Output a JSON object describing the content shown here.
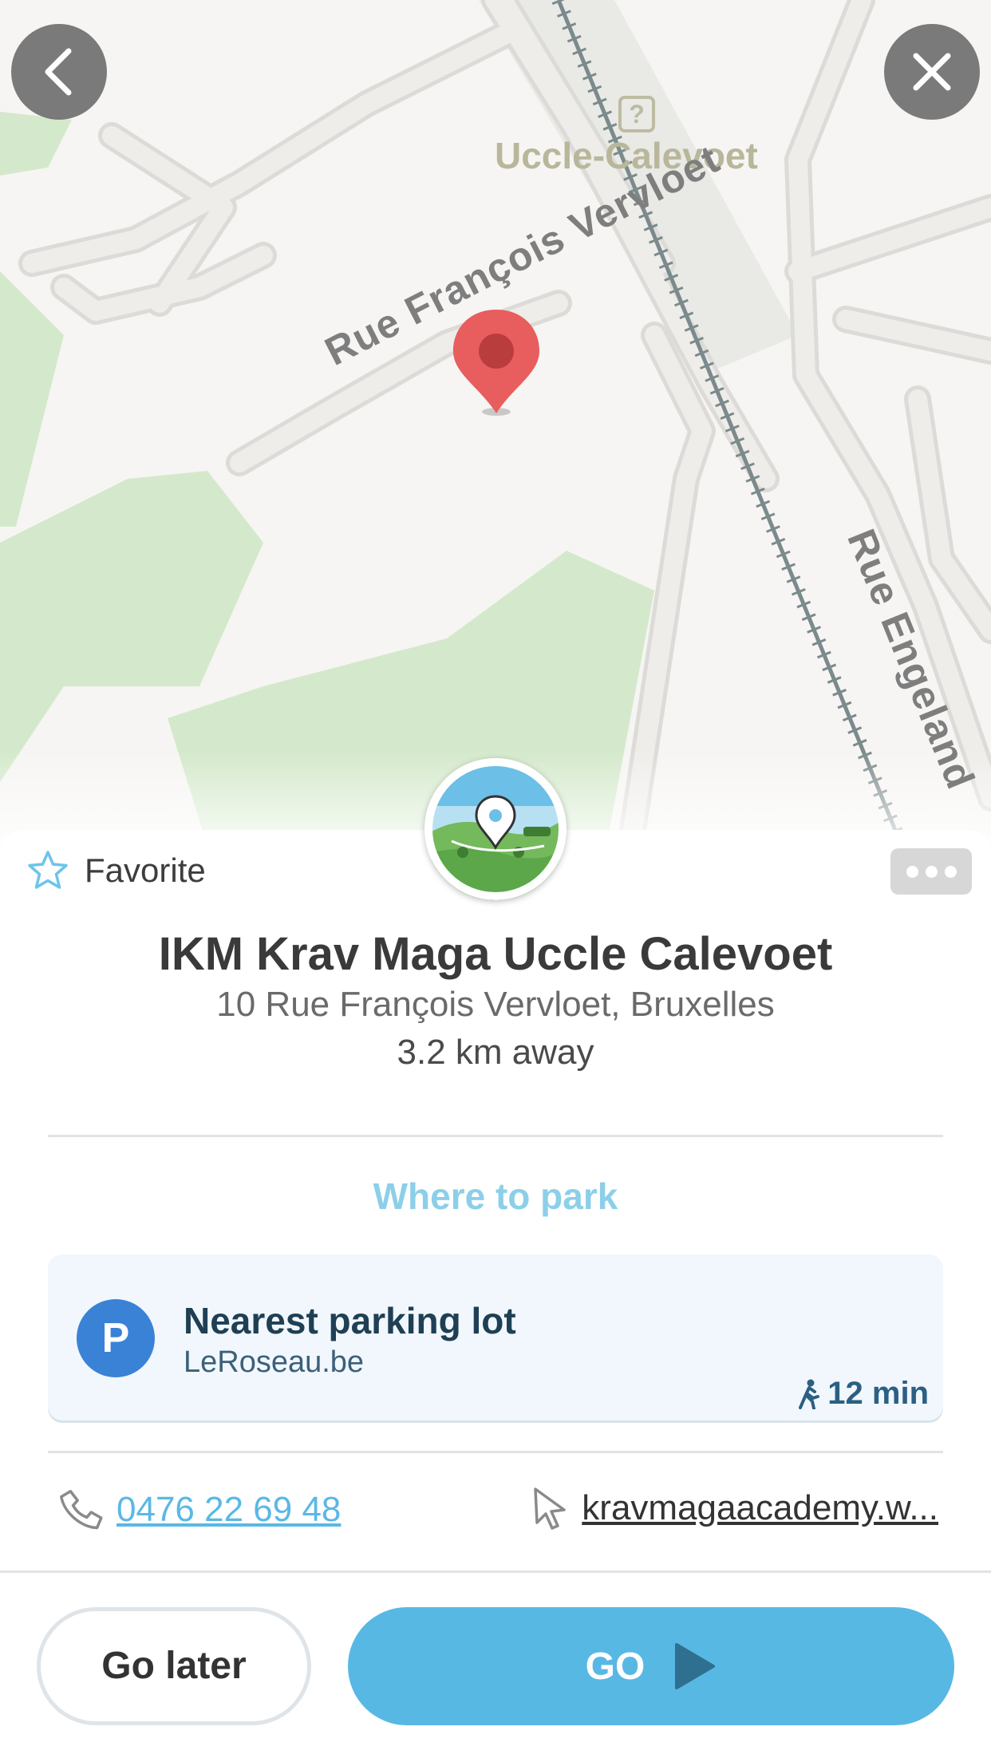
{
  "map": {
    "station_label": "Uccle-Calevoet",
    "street_label_1": "Rue François Vervloet",
    "street_label_2": "Rue Engeland",
    "station_icon": "?"
  },
  "header": {
    "back_icon": "chevron-left-icon",
    "close_icon": "close-icon"
  },
  "sheet": {
    "favorite_label": "Favorite",
    "more_icon": "more-dots-icon",
    "place": {
      "name": "IKM Krav Maga Uccle Calevoet",
      "address": "10 Rue François Vervloet, Bruxelles",
      "distance": "3.2 km away"
    },
    "parking": {
      "header": "Where to park",
      "badge": "P",
      "title": "Nearest parking lot",
      "subtitle": "LeRoseau.be",
      "walk_time": "12 min"
    },
    "contact": {
      "phone": "0476 22 69 48",
      "website": "kravmagaacademy.w..."
    },
    "actions": {
      "go_later": "Go later",
      "go": "GO"
    }
  },
  "colors": {
    "accent": "#58b8e4",
    "park_header": "#8ccfe9",
    "parking_badge": "#3a82d6",
    "pin": "#e85d5d"
  }
}
